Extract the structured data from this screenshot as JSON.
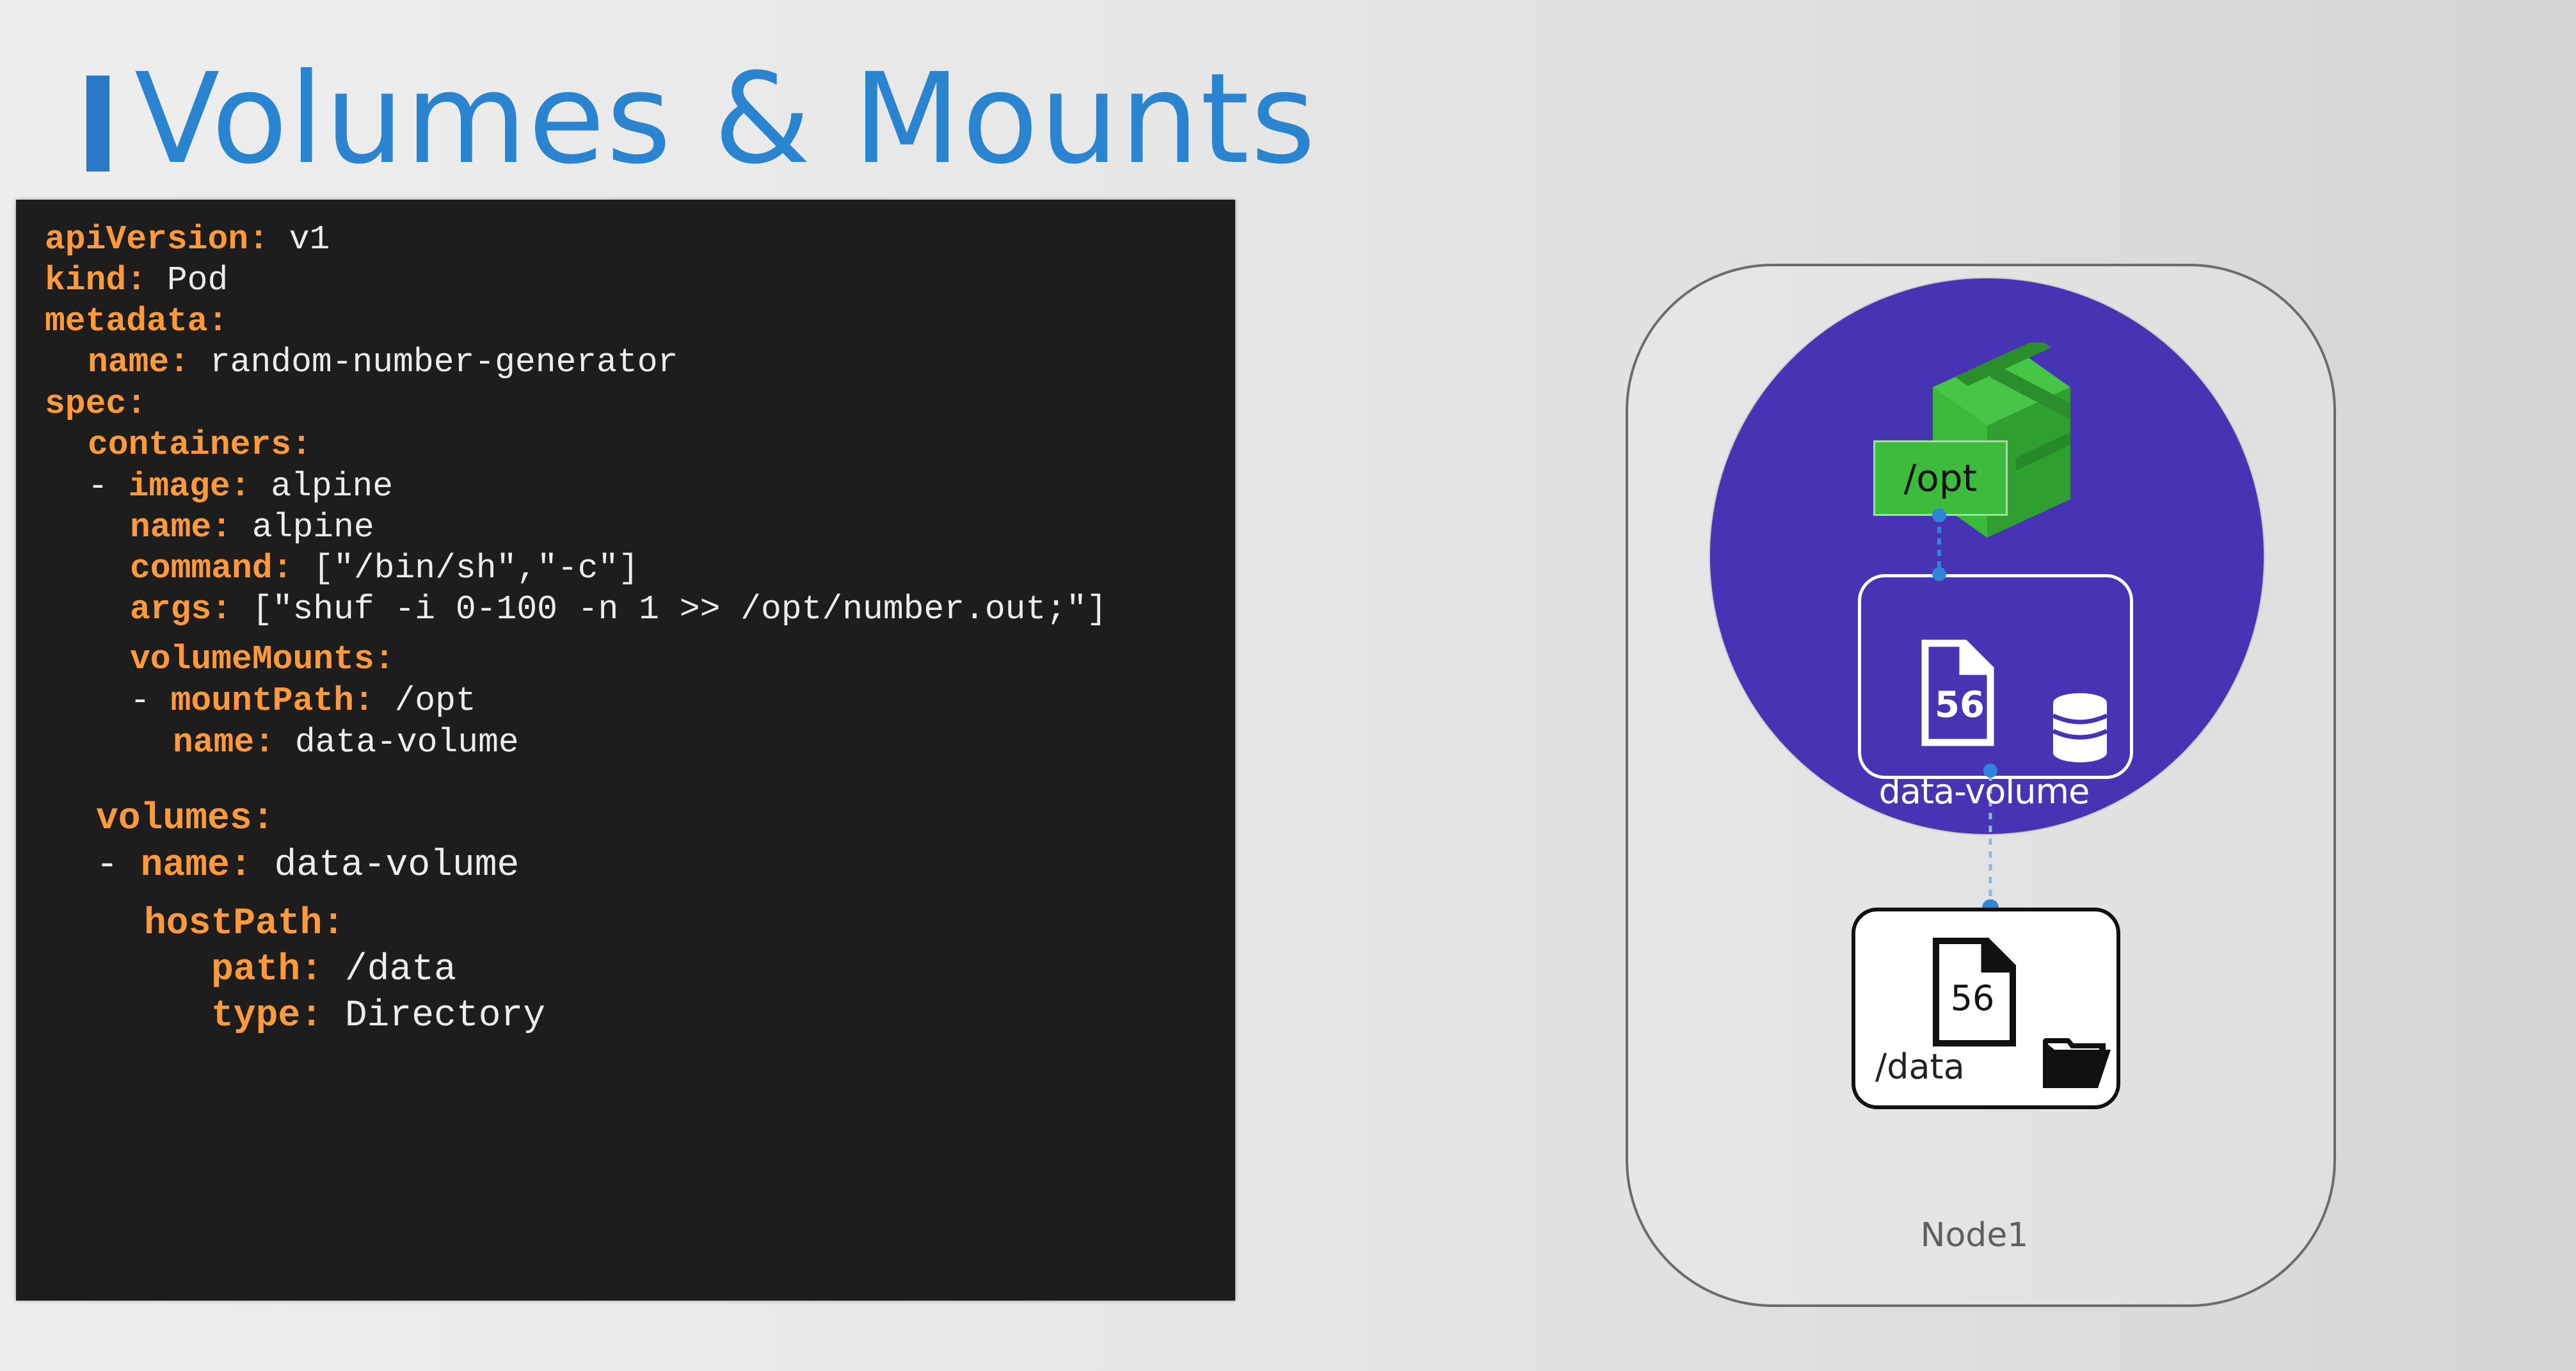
{
  "slide": {
    "title": "Volumes & Mounts",
    "accent_color": "#2a84cf"
  },
  "code": {
    "lines": [
      {
        "key": "apiVersion",
        "value": "v1"
      },
      {
        "key": "kind",
        "value": "Pod"
      },
      {
        "key": "metadata",
        "value": ""
      },
      {
        "key": "name",
        "value": "random-number-generator"
      },
      {
        "key": "spec",
        "value": ""
      },
      {
        "key": "containers",
        "value": ""
      },
      {
        "key": "image",
        "value": "alpine"
      },
      {
        "key": "name",
        "value": "alpine"
      },
      {
        "key": "command",
        "value": "[\"/bin/sh\",\"-c\"]"
      },
      {
        "key": "args",
        "value": "[\"shuf -i 0-100 -n 1 >> /opt/number.out;\"]"
      },
      {
        "key": "volumeMounts",
        "value": ""
      },
      {
        "key": "mountPath",
        "value": "/opt"
      },
      {
        "key": "name",
        "value": "data-volume"
      },
      {
        "key": "volumes",
        "value": ""
      },
      {
        "key": "name",
        "value": "data-volume"
      },
      {
        "key": "hostPath",
        "value": ""
      },
      {
        "key": "path",
        "value": "/data"
      },
      {
        "key": "type",
        "value": "Directory"
      }
    ],
    "key_color": "#ff9a3c",
    "value_color": "#ededed"
  },
  "diagram": {
    "container_mount_label": "/opt",
    "volume_label": "data-volume",
    "volume_file_number": "56",
    "host_file_number": "56",
    "host_path_label": "/data",
    "node_label": "Node1",
    "pod_color": "#4734b4",
    "container_color": "#3dbb3d",
    "connector_color": "#2f86d8"
  }
}
